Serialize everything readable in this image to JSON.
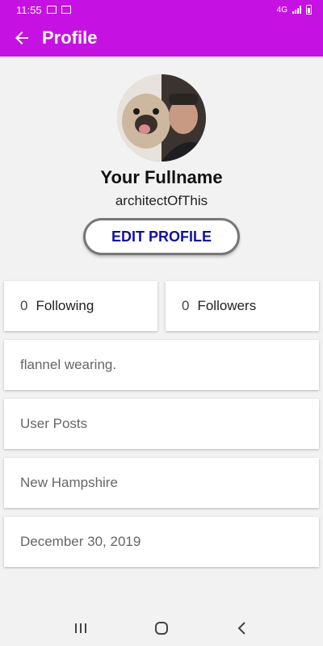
{
  "status_bar": {
    "time": "11:55",
    "network": "4G"
  },
  "app_bar": {
    "title": "Profile"
  },
  "profile": {
    "fullname": "Your Fullname",
    "username": "architectOfThis",
    "edit_button_label": "EDIT PROFILE"
  },
  "stats": {
    "following_count": "0",
    "following_label": "Following",
    "followers_count": "0",
    "followers_label": "Followers"
  },
  "info_cards": {
    "bio": "flannel wearing.",
    "posts": "User Posts",
    "location": "New Hampshire",
    "date": "December 30, 2019"
  },
  "colors": {
    "accent": "#c611e3",
    "button_text": "#1010a8"
  },
  "icons": {
    "back": "arrow-left-icon",
    "recents": "recents-icon",
    "home": "home-icon",
    "nav_back": "chevron-left-icon"
  }
}
